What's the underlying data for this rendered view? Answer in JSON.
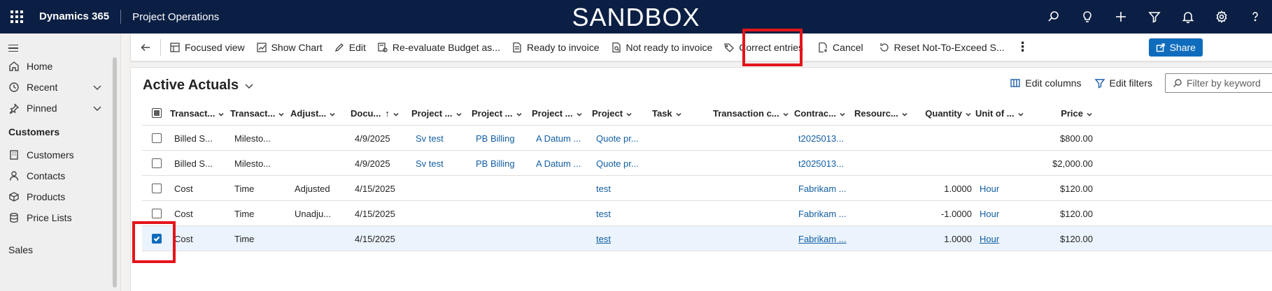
{
  "topbar": {
    "brand": "Dynamics 365",
    "app_name": "Project Operations",
    "environment": "SANDBOX",
    "icons": [
      "search-icon",
      "lightbulb-icon",
      "plus-icon",
      "filter-icon",
      "bell-icon",
      "gear-icon",
      "help-icon"
    ]
  },
  "sidebar": {
    "items": [
      {
        "label": "Home",
        "icon": "home-icon"
      },
      {
        "label": "Recent",
        "icon": "clock-icon"
      },
      {
        "label": "Pinned",
        "icon": "pin-icon"
      }
    ],
    "group_customers": "Customers",
    "customer_items": [
      {
        "label": "Customers",
        "icon": "building-icon"
      },
      {
        "label": "Contacts",
        "icon": "person-icon"
      },
      {
        "label": "Products",
        "icon": "box-icon"
      },
      {
        "label": "Price Lists",
        "icon": "database-icon"
      }
    ],
    "group_sales": "Sales"
  },
  "commandbar": {
    "items": [
      {
        "label": "Focused view",
        "icon": "focused-view-icon"
      },
      {
        "label": "Show Chart",
        "icon": "chart-icon"
      },
      {
        "label": "Edit",
        "icon": "pencil-icon"
      },
      {
        "label": "Re-evaluate Budget as...",
        "icon": "reevaluate-icon"
      },
      {
        "label": "Ready to invoice",
        "icon": "document-icon"
      },
      {
        "label": "Not ready to invoice",
        "icon": "document-search-icon"
      },
      {
        "label": "Correct entries",
        "icon": "tag-edit-icon"
      },
      {
        "label": "Cancel",
        "icon": "document-cancel-icon"
      },
      {
        "label": "Reset Not-To-Exceed S...",
        "icon": "reset-icon"
      }
    ],
    "share_label": "Share"
  },
  "view": {
    "title": "Active Actuals",
    "edit_columns": "Edit columns",
    "edit_filters": "Edit filters",
    "filter_placeholder": "Filter by keyword"
  },
  "table": {
    "headers": [
      "Transact...",
      "Transact...",
      "Adjust...",
      "Docu...",
      "Project ...",
      "Project ...",
      "Project ...",
      "Project",
      "Task",
      "Transaction c...",
      "Contrac...",
      "Resourc...",
      "Quantity",
      "Unit of ...",
      "Price"
    ],
    "rows": [
      [
        "Billed S...",
        "Milesto...",
        "",
        "4/9/2025",
        "Sv test",
        "PB Billing",
        "A Datum ...",
        "Quote pr...",
        "",
        "",
        "t2025013...",
        "",
        "",
        "",
        "$800.00"
      ],
      [
        "Billed S...",
        "Milesto...",
        "",
        "4/9/2025",
        "Sv test",
        "PB Billing",
        "A Datum ...",
        "Quote pr...",
        "",
        "",
        "t2025013...",
        "",
        "",
        "",
        "$2,000.00"
      ],
      [
        "Cost",
        "Time",
        "Adjusted",
        "4/15/2025",
        "",
        "",
        "",
        "test",
        "",
        "",
        "Fabrikam ...",
        "",
        "1.0000",
        "Hour",
        "$120.00"
      ],
      [
        "Cost",
        "Time",
        "Unadju...",
        "4/15/2025",
        "",
        "",
        "",
        "test",
        "",
        "",
        "Fabrikam ...",
        "",
        "-1.0000",
        "Hour",
        "$120.00"
      ],
      [
        "Cost",
        "Time",
        "",
        "4/15/2025",
        "",
        "",
        "",
        "test",
        "",
        "",
        "Fabrikam ...",
        "",
        "1.0000",
        "Hour",
        "$120.00"
      ]
    ],
    "selected_row_index": 4
  },
  "colors": {
    "topbar_bg": "#0b1f44",
    "link": "#115ea3",
    "highlight_border": "#e3151a",
    "selected_row_bg": "#ebf3fc",
    "share_button": "#0f6cbd"
  }
}
